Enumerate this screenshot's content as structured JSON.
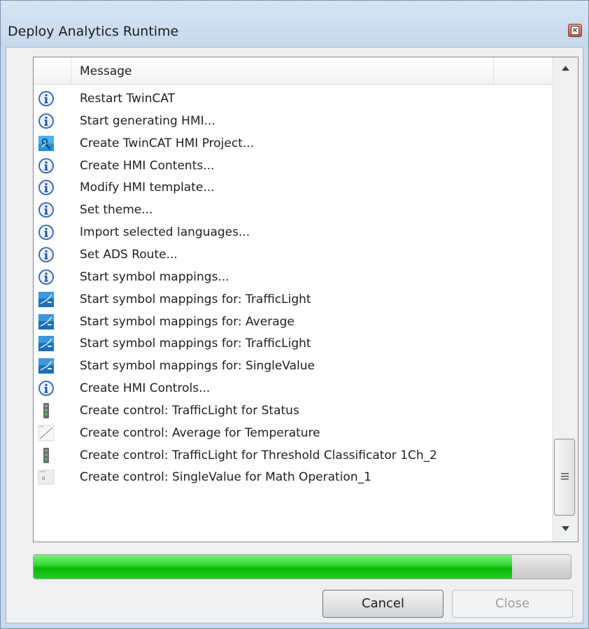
{
  "window": {
    "title": "Deploy Analytics Runtime"
  },
  "list": {
    "column_header": "Message",
    "rows": [
      {
        "icon": "info-icon",
        "text": "Restart TwinCAT"
      },
      {
        "icon": "info-icon",
        "text": "Start generating HMI..."
      },
      {
        "icon": "hmi-project-icon",
        "text": "Create TwinCAT HMI Project..."
      },
      {
        "icon": "info-icon",
        "text": "Create HMI Contents..."
      },
      {
        "icon": "info-icon",
        "text": "Modify HMI template..."
      },
      {
        "icon": "info-icon",
        "text": "Set theme..."
      },
      {
        "icon": "info-icon",
        "text": "Import selected languages..."
      },
      {
        "icon": "info-icon",
        "text": "Set ADS Route..."
      },
      {
        "icon": "info-icon",
        "text": "Start symbol mappings..."
      },
      {
        "icon": "symbol-mapping-icon",
        "text": "Start symbol mappings for: TrafficLight"
      },
      {
        "icon": "symbol-mapping-icon",
        "text": "Start symbol mappings for: Average"
      },
      {
        "icon": "symbol-mapping-icon",
        "text": "Start symbol mappings for: TrafficLight"
      },
      {
        "icon": "symbol-mapping-icon",
        "text": "Start symbol mappings for: SingleValue"
      },
      {
        "icon": "info-icon",
        "text": "Create HMI Controls..."
      },
      {
        "icon": "traffic-light-icon",
        "text": "Create control: TrafficLight for Status"
      },
      {
        "icon": "line-chart-icon",
        "text": "Create control: Average for Temperature"
      },
      {
        "icon": "traffic-light-icon",
        "text": "Create control: TrafficLight for Threshold Classificator 1Ch_2"
      },
      {
        "icon": "single-value-icon",
        "text": "Create control: SingleValue for Math Operation_1"
      }
    ]
  },
  "progress": {
    "fraction": 0.89
  },
  "buttons": {
    "cancel_label": "Cancel",
    "close_label": "Close"
  },
  "colors": {
    "progress_green": "#22cc22",
    "info_blue": "#1f5fbf",
    "symbol_icon_blue": "#1b7bc4"
  }
}
